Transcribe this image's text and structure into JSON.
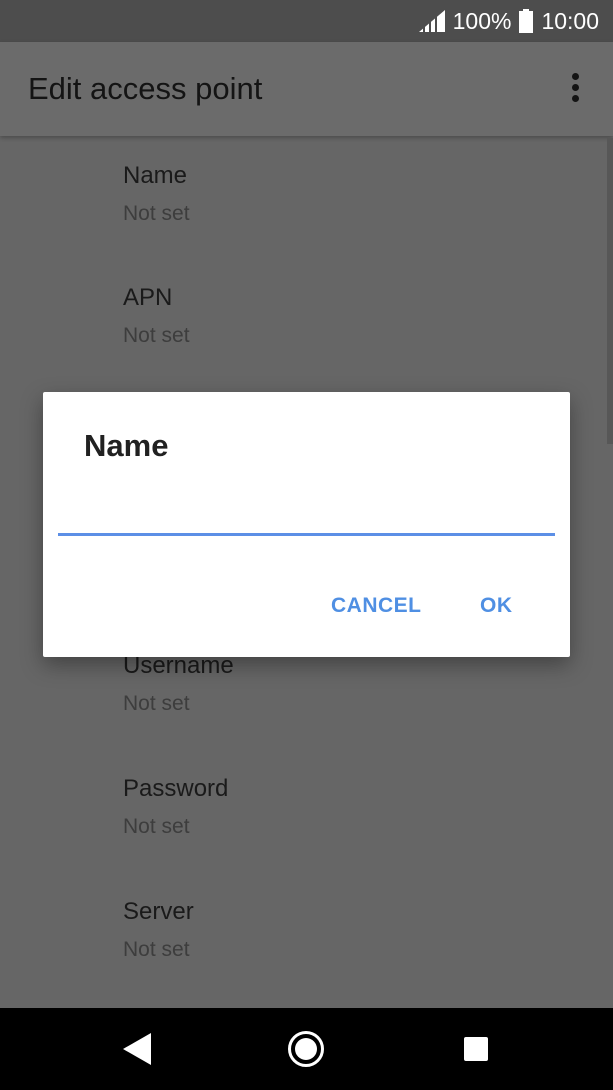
{
  "status_bar": {
    "battery_percent": "100%",
    "time": "10:00",
    "icons": [
      "signal-icon",
      "battery-icon"
    ]
  },
  "app_bar": {
    "title": "Edit access point",
    "menu_icon": "overflow-menu-icon"
  },
  "preferences": [
    {
      "title": "Name",
      "summary": "Not set"
    },
    {
      "title": "APN",
      "summary": "Not set"
    },
    {
      "title": "Username",
      "summary": "Not set"
    },
    {
      "title": "Password",
      "summary": "Not set"
    },
    {
      "title": "Server",
      "summary": "Not set"
    }
  ],
  "dialog": {
    "title": "Name",
    "input_value": "",
    "cancel_label": "CANCEL",
    "ok_label": "OK",
    "accent_color": "#4f8fe3"
  },
  "nav_bar": {
    "icons": [
      "back-icon",
      "home-icon",
      "recent-apps-icon"
    ]
  }
}
